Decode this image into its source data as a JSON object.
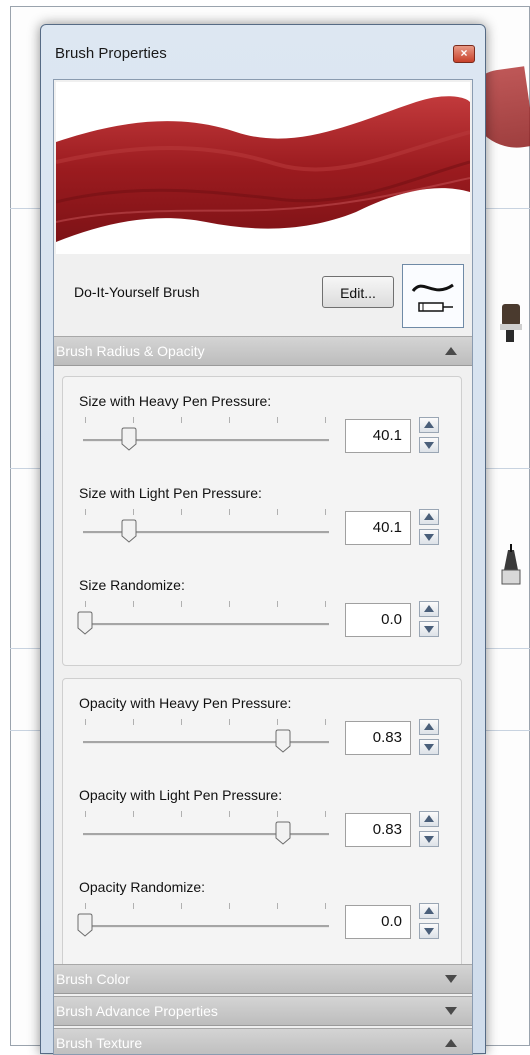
{
  "window": {
    "title": "Brush Properties",
    "close_label": "×"
  },
  "brush": {
    "name": "Do-It-Yourself Brush",
    "edit_label": "Edit...",
    "stroke_color": "#9b1b1f"
  },
  "sections": [
    {
      "label": "Brush Radius & Opacity",
      "state": "expanded"
    },
    {
      "label": "Brush Color",
      "state": "collapsed"
    },
    {
      "label": "Brush Advance Properties",
      "state": "collapsed"
    },
    {
      "label": "Brush Texture",
      "state": "expanded"
    }
  ],
  "size_group": [
    {
      "label": "Size with Heavy Pen Pressure:",
      "value": "40.1",
      "level": 0.18
    },
    {
      "label": "Size with Light Pen Pressure:",
      "value": "40.1",
      "level": 0.18
    },
    {
      "label": "Size Randomize:",
      "value": "0.0",
      "level": 0.0
    }
  ],
  "opacity_group": [
    {
      "label": "Opacity with Heavy Pen Pressure:",
      "value": "0.83",
      "level": 0.82
    },
    {
      "label": "Opacity with Light Pen Pressure:",
      "value": "0.83",
      "level": 0.82
    },
    {
      "label": "Opacity Randomize:",
      "value": "0.0",
      "level": 0.0
    }
  ],
  "colors": {
    "accent": "#9b1b1f",
    "header_bg": "#c4c4c4",
    "frame": "#566b85"
  }
}
